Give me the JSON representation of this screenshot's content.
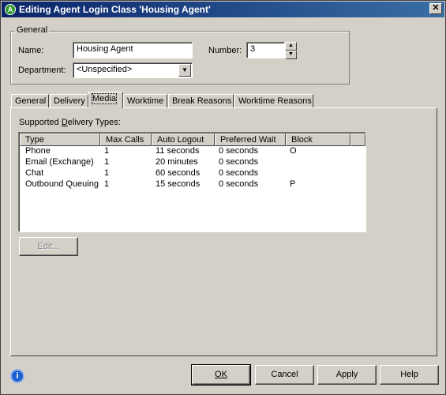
{
  "window": {
    "title": "Editing Agent Login Class 'Housing Agent'",
    "close_glyph": "✕"
  },
  "general": {
    "group_label": "General",
    "name_label": "Name:",
    "name_value": "Housing Agent",
    "number_label": "Number:",
    "number_value": "3",
    "department_label": "Department:",
    "department_value": "<Unspecified>"
  },
  "tabs": [
    "General",
    "Delivery",
    "Media",
    "Worktime",
    "Break Reasons",
    "Worktime Reasons"
  ],
  "active_tab": "Media",
  "media": {
    "list_label_pre": "Supported ",
    "list_label_ul": "D",
    "list_label_post": "elivery Types:",
    "columns": [
      "Type",
      "Max Calls",
      "Auto Logout",
      "Preferred Wait",
      "Block"
    ],
    "rows": [
      [
        "Phone",
        "1",
        "11 seconds",
        "0 seconds",
        "O"
      ],
      [
        "Email (Exchange)",
        "1",
        "20 minutes",
        "0 seconds",
        ""
      ],
      [
        "Chat",
        "1",
        "60 seconds",
        "0 seconds",
        ""
      ],
      [
        "Outbound Queuing",
        "1",
        "15 seconds",
        "0 seconds",
        "P"
      ]
    ],
    "edit_button": "Edit..."
  },
  "buttons": {
    "ok": "OK",
    "cancel": "Cancel",
    "apply": "Apply",
    "help": "Help"
  },
  "colors": {
    "face": "#d4d0c8",
    "title_start": "#0a246a",
    "title_end": "#3a6ea5"
  }
}
